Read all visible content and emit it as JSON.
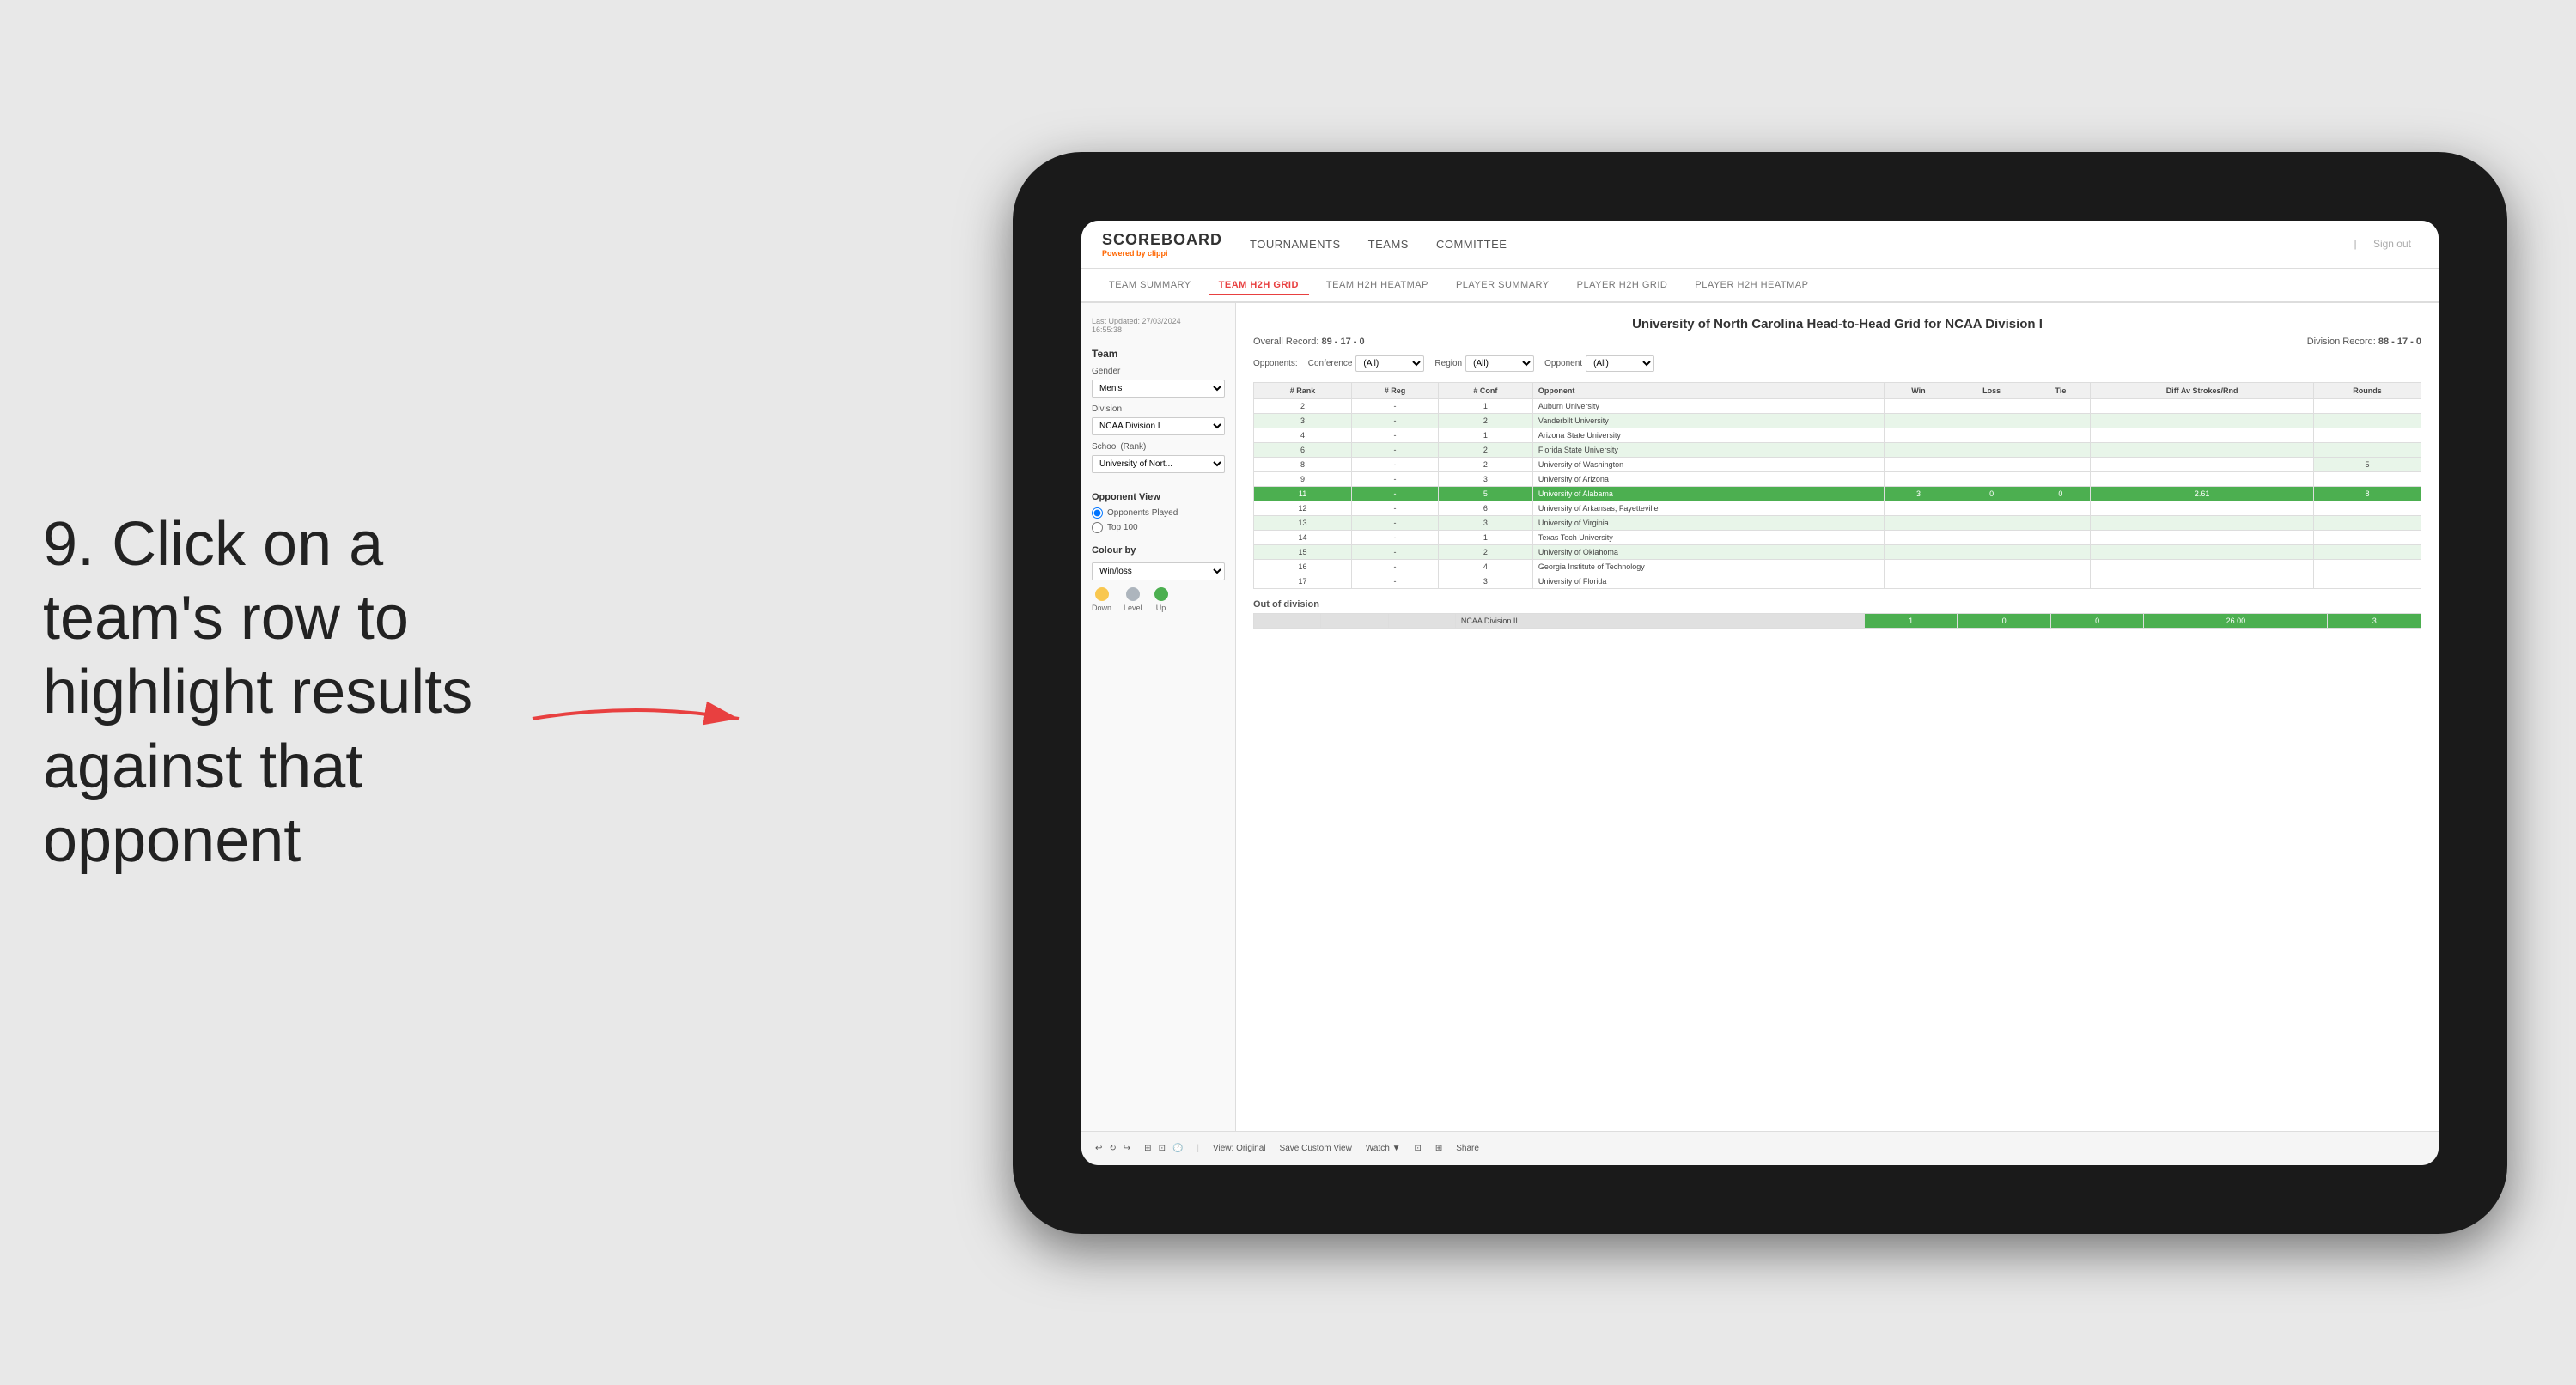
{
  "instruction": {
    "step": "9.",
    "text": "Click on a team's row to highlight results against that opponent"
  },
  "nav": {
    "logo": "SCOREBOARD",
    "powered_by": "Powered by",
    "brand": "clippi",
    "items": [
      "TOURNAMENTS",
      "TEAMS",
      "COMMITTEE"
    ],
    "sign_out": "Sign out"
  },
  "sub_nav": {
    "items": [
      "TEAM SUMMARY",
      "TEAM H2H GRID",
      "TEAM H2H HEATMAP",
      "PLAYER SUMMARY",
      "PLAYER H2H GRID",
      "PLAYER H2H HEATMAP"
    ],
    "active": "TEAM H2H GRID"
  },
  "sidebar": {
    "timestamp": "Last Updated: 27/03/2024",
    "time": "16:55:38",
    "team_label": "Team",
    "gender_label": "Gender",
    "gender_value": "Men's",
    "division_label": "Division",
    "division_value": "NCAA Division I",
    "school_label": "School (Rank)",
    "school_value": "University of Nort...",
    "opponent_view_label": "Opponent View",
    "opponents_played": "Opponents Played",
    "top100": "Top 100",
    "colour_by_label": "Colour by",
    "colour_by_value": "Win/loss",
    "legend": {
      "down_label": "Down",
      "down_color": "#f9c74f",
      "level_label": "Level",
      "level_color": "#adb5bd",
      "up_label": "Up",
      "up_color": "#4caf50"
    }
  },
  "grid": {
    "title": "University of North Carolina Head-to-Head Grid for NCAA Division I",
    "overall_record_label": "Overall Record:",
    "overall_record": "89 - 17 - 0",
    "division_record_label": "Division Record:",
    "division_record": "88 - 17 - 0",
    "filters": {
      "opponents_label": "Opponents:",
      "conference_label": "Conference",
      "conference_value": "(All)",
      "region_label": "Region",
      "region_value": "(All)",
      "opponent_label": "Opponent",
      "opponent_value": "(All)"
    },
    "columns": [
      "# Rank",
      "# Reg",
      "# Conf",
      "Opponent",
      "Win",
      "Loss",
      "Tie",
      "Diff Av Strokes/Rnd",
      "Rounds"
    ],
    "rows": [
      {
        "rank": "2",
        "reg": "-",
        "conf": "1",
        "opponent": "Auburn University",
        "win": "",
        "loss": "",
        "tie": "",
        "diff": "",
        "rounds": "",
        "style": "normal"
      },
      {
        "rank": "3",
        "reg": "-",
        "conf": "2",
        "opponent": "Vanderbilt University",
        "win": "",
        "loss": "",
        "tie": "",
        "diff": "",
        "rounds": "",
        "style": "light-green"
      },
      {
        "rank": "4",
        "reg": "-",
        "conf": "1",
        "opponent": "Arizona State University",
        "win": "",
        "loss": "",
        "tie": "",
        "diff": "",
        "rounds": "",
        "style": "normal"
      },
      {
        "rank": "6",
        "reg": "-",
        "conf": "2",
        "opponent": "Florida State University",
        "win": "",
        "loss": "",
        "tie": "",
        "diff": "",
        "rounds": "",
        "style": "light-green"
      },
      {
        "rank": "8",
        "reg": "-",
        "conf": "2",
        "opponent": "University of Washington",
        "win": "",
        "loss": "",
        "tie": "",
        "diff": "",
        "rounds": "5",
        "style": "normal"
      },
      {
        "rank": "9",
        "reg": "-",
        "conf": "3",
        "opponent": "University of Arizona",
        "win": "",
        "loss": "",
        "tie": "",
        "diff": "",
        "rounds": "",
        "style": "normal"
      },
      {
        "rank": "11",
        "reg": "-",
        "conf": "5",
        "opponent": "University of Alabama",
        "win": "3",
        "loss": "0",
        "tie": "0",
        "diff": "2.61",
        "rounds": "8",
        "style": "highlighted"
      },
      {
        "rank": "12",
        "reg": "-",
        "conf": "6",
        "opponent": "University of Arkansas, Fayetteville",
        "win": "",
        "loss": "",
        "tie": "",
        "diff": "",
        "rounds": "",
        "style": "normal"
      },
      {
        "rank": "13",
        "reg": "-",
        "conf": "3",
        "opponent": "University of Virginia",
        "win": "",
        "loss": "",
        "tie": "",
        "diff": "",
        "rounds": "",
        "style": "light-green"
      },
      {
        "rank": "14",
        "reg": "-",
        "conf": "1",
        "opponent": "Texas Tech University",
        "win": "",
        "loss": "",
        "tie": "",
        "diff": "",
        "rounds": "",
        "style": "normal"
      },
      {
        "rank": "15",
        "reg": "-",
        "conf": "2",
        "opponent": "University of Oklahoma",
        "win": "",
        "loss": "",
        "tie": "",
        "diff": "",
        "rounds": "",
        "style": "light-green"
      },
      {
        "rank": "16",
        "reg": "-",
        "conf": "4",
        "opponent": "Georgia Institute of Technology",
        "win": "",
        "loss": "",
        "tie": "",
        "diff": "",
        "rounds": "",
        "style": "normal"
      },
      {
        "rank": "17",
        "reg": "-",
        "conf": "3",
        "opponent": "University of Florida",
        "win": "",
        "loss": "",
        "tie": "",
        "diff": "",
        "rounds": "",
        "style": "normal"
      }
    ],
    "out_of_division_label": "Out of division",
    "out_of_division_row": {
      "label": "NCAA Division II",
      "win": "1",
      "loss": "0",
      "tie": "0",
      "diff": "26.00",
      "rounds": "3"
    }
  },
  "toolbar": {
    "items": [
      "View: Original",
      "Save Custom View",
      "Watch ▼",
      "Share"
    ]
  }
}
